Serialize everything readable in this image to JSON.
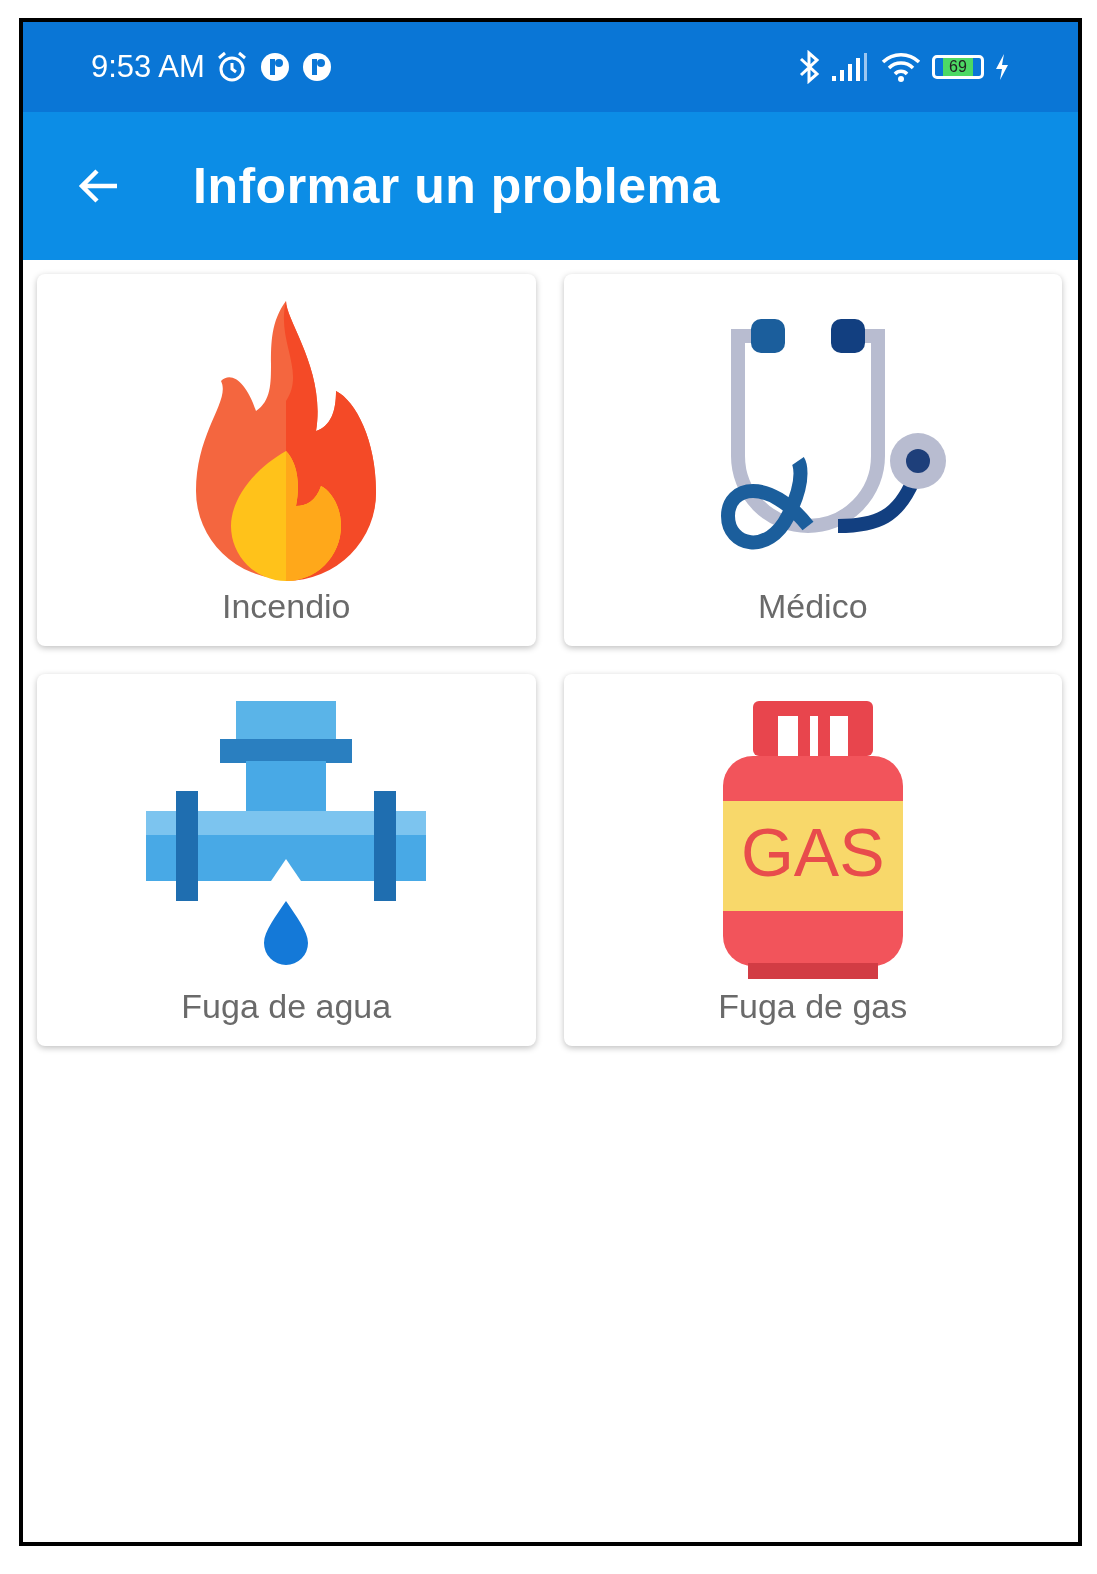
{
  "status_bar": {
    "time": "9:53 AM",
    "battery": "69"
  },
  "app_bar": {
    "title": "Informar un problema"
  },
  "categories": [
    {
      "kind": "fire",
      "label": "Incendio"
    },
    {
      "kind": "medical",
      "label": "Médico"
    },
    {
      "kind": "water",
      "label": "Fuga de agua"
    },
    {
      "kind": "gas",
      "label": "Fuga de gas"
    }
  ],
  "gas_cylinder": {
    "text": "GAS"
  }
}
